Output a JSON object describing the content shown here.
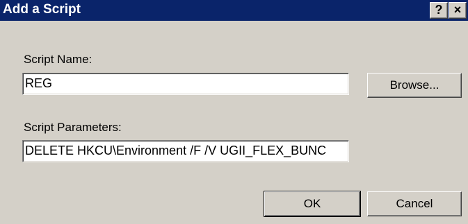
{
  "window": {
    "title": "Add a Script",
    "help_label": "?",
    "close_label": "×"
  },
  "form": {
    "script_name_label": "Script Name:",
    "script_name_value": "REG",
    "script_params_label": "Script Parameters:",
    "script_params_value": "DELETE HKCU\\Environment /F /V UGII_FLEX_BUNC"
  },
  "buttons": {
    "browse_label": "Browse...",
    "ok_label": "OK",
    "cancel_label": "Cancel"
  },
  "colors": {
    "titlebar": "#0a246a",
    "face": "#d4d0c8"
  }
}
